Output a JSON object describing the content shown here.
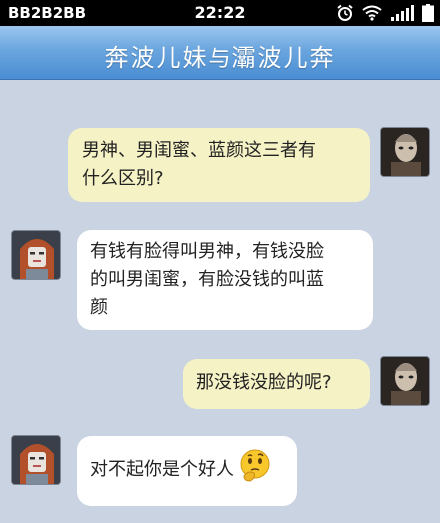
{
  "status_bar": {
    "carrier": "BB2B2BB",
    "time": "22:22",
    "icons": [
      "alarm-clock-icon",
      "wifi-icon",
      "signal-icon",
      "battery-icon"
    ]
  },
  "header": {
    "title_left": "奔波儿妹",
    "title_mid": "与",
    "title_right": "灞波儿奔"
  },
  "messages": [
    {
      "sender": "self",
      "lines": [
        "男神、男闺蜜、蓝颜这三者有",
        "什么区别?"
      ]
    },
    {
      "sender": "other",
      "lines": [
        "有钱有脸得叫男神，有钱没脸",
        "的叫男闺蜜，有脸没钱的叫蓝",
        "颜"
      ]
    },
    {
      "sender": "self",
      "lines": [
        "那没钱没脸的呢?"
      ]
    },
    {
      "sender": "other",
      "lines": [
        "对不起你是个好人"
      ],
      "emoji": "thinking-face-icon"
    }
  ],
  "colors": {
    "background": "#c9d3e2",
    "outgoing_bubble": "#f5f2c6",
    "incoming_bubble": "#ffffff",
    "title_bar": "#5a9ad9"
  }
}
